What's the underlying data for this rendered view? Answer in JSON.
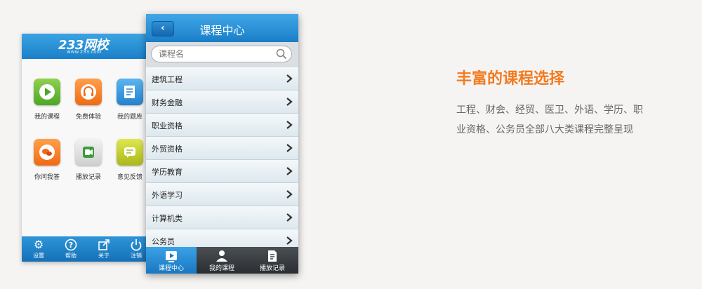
{
  "home_app": {
    "brand": "233网校",
    "url": "www.233.com",
    "tiles": [
      {
        "label": "我的课程",
        "icon": "play-icon",
        "color": "#5bb534"
      },
      {
        "label": "免费体验",
        "icon": "headphones-icon",
        "color": "#f47a20"
      },
      {
        "label": "我的题库",
        "icon": "notebook-icon",
        "color": "#2b8ad6"
      },
      {
        "label": "你问我答",
        "icon": "chat-icon",
        "color": "#f47a20"
      },
      {
        "label": "播放记录",
        "icon": "video-record-icon",
        "color": "#d4d4d4"
      },
      {
        "label": "意见反馈",
        "icon": "feedback-icon",
        "color": "#b9c52a"
      }
    ],
    "bottom_bar": [
      {
        "label": "设置",
        "icon": "gear-icon"
      },
      {
        "label": "帮助",
        "icon": "help-icon"
      },
      {
        "label": "关于",
        "icon": "share-icon"
      },
      {
        "label": "注销",
        "icon": "power-icon"
      }
    ]
  },
  "course_center": {
    "title": "课程中心",
    "search_placeholder": "课程名",
    "courses": [
      "建筑工程",
      "财务金融",
      "职业资格",
      "外贸资格",
      "学历教育",
      "外语学习",
      "计算机类",
      "公务员"
    ],
    "tabs": [
      {
        "label": "课程中心",
        "icon": "course-center-icon",
        "active": true
      },
      {
        "label": "我的课程",
        "icon": "my-course-icon",
        "active": false
      },
      {
        "label": "播放记录",
        "icon": "play-record-icon",
        "active": false
      }
    ]
  },
  "feature": {
    "title": "丰富的课程选择",
    "description": "工程、财会、经贸、医卫、外语、学历、职业资格、公务员全部八大类课程完整呈现"
  },
  "colors": {
    "accent_orange": "#f47a20",
    "header_blue": "#1b80c9",
    "page_bg": "#f5f4f2"
  }
}
